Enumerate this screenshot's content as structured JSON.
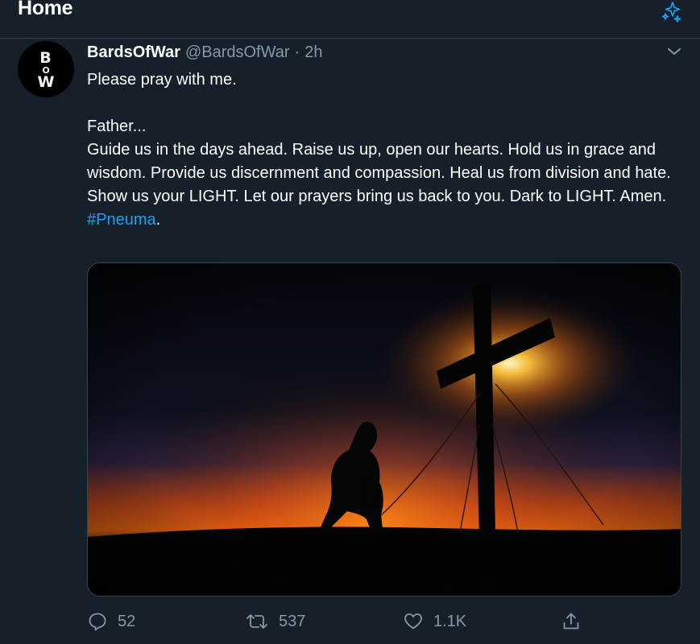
{
  "header": {
    "title": "Home",
    "sparkle_icon": "sparkle-icon"
  },
  "tweet": {
    "author": {
      "name": "BardsOfWar",
      "handle": "@BardsOfWar",
      "separator": "·",
      "time": "2h",
      "avatar_letters": {
        "top": "B",
        "middle": "O",
        "bottom": "W"
      }
    },
    "text": {
      "line1": "Please pray with me.",
      "line2": "Father...",
      "line3": "Guide us in the days ahead. Raise us up, open our hearts. Hold us in grace and wisdom. Provide us discernment and compassion. Heal us from division and hate. Show us your LIGHT. Let our prayers bring us back to you.  Dark to LIGHT. Amen.",
      "hashtag": "#Pneuma",
      "hashtag_suffix": "."
    },
    "actions": {
      "reply_count": "52",
      "retweet_count": "537",
      "like_count": "1.1K"
    }
  },
  "colors": {
    "background": "#15202b",
    "border": "#38444d",
    "secondary_text": "#8899a6",
    "accent": "#1da1f2"
  }
}
